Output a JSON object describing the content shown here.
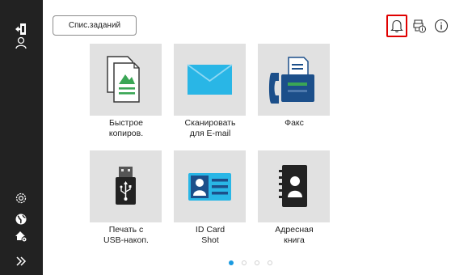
{
  "toolbar": {
    "job_list_label": "Спис.заданий"
  },
  "sidebar": {
    "items": [
      {
        "icon": "logout-icon"
      },
      {
        "icon": "user-icon"
      },
      {
        "icon": "settings-icon"
      },
      {
        "icon": "globe-icon"
      },
      {
        "icon": "accessibility-icon"
      },
      {
        "icon": "expand-icon"
      }
    ]
  },
  "top_icons": [
    {
      "icon": "bell-icon",
      "highlighted": true,
      "highlight_color": "#e00000"
    },
    {
      "icon": "device-info-icon"
    },
    {
      "icon": "info-icon"
    }
  ],
  "tiles": [
    {
      "id": "quick-copy",
      "icon": "copy-icon",
      "label_line1": "Быстрое",
      "label_line2": "копиров."
    },
    {
      "id": "scan-email",
      "icon": "email-icon",
      "label_line1": "Сканировать",
      "label_line2": "для E-mail"
    },
    {
      "id": "fax",
      "icon": "fax-icon",
      "label_line1": "Факс",
      "label_line2": ""
    },
    {
      "id": "usb-print",
      "icon": "usb-icon",
      "label_line1": "Печать с",
      "label_line2": "USB-накоп."
    },
    {
      "id": "id-card-shot",
      "icon": "id-card-icon",
      "label_line1": "ID Card",
      "label_line2": "Shot"
    },
    {
      "id": "address-book",
      "icon": "address-book-icon",
      "label_line1": "Адресная",
      "label_line2": "книга"
    }
  ],
  "pager": {
    "pages": 4,
    "current": 1,
    "active_color": "#1a9ae0"
  },
  "colors": {
    "sidebar": "#222222",
    "tile_bg": "#e1e1e1",
    "accent_green": "#3aa655",
    "accent_blue": "#29b6e6",
    "accent_navy": "#1c4f8a"
  }
}
